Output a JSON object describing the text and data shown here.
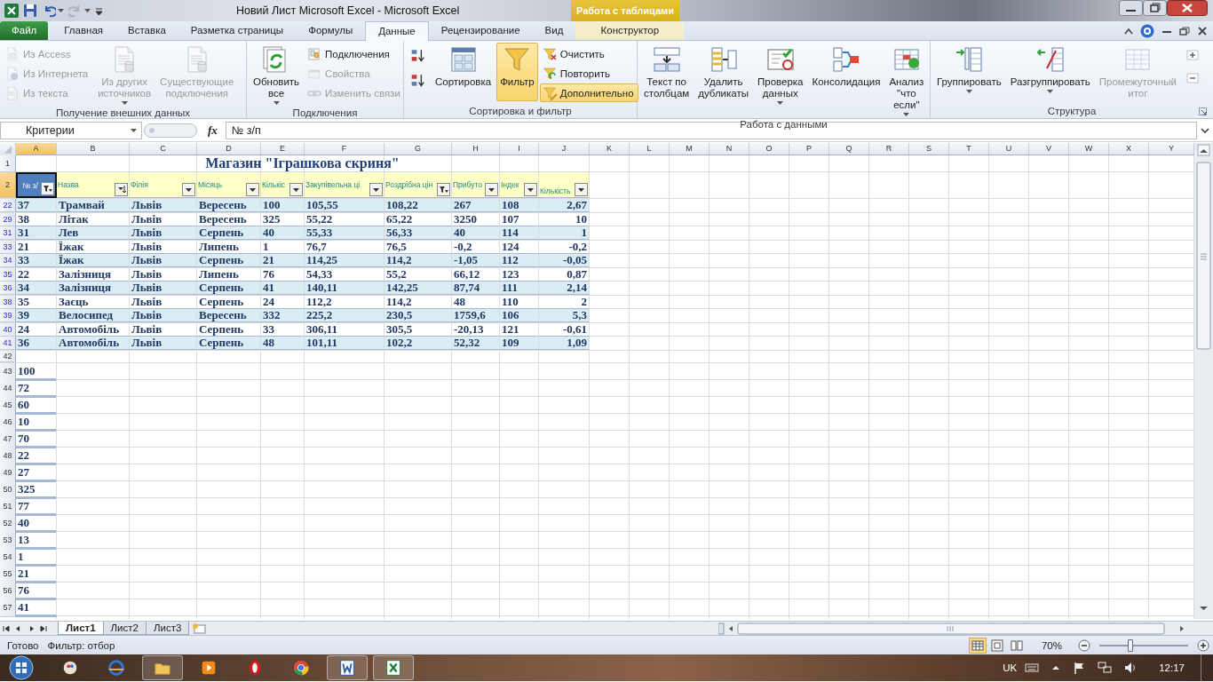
{
  "window": {
    "title": "Новий Лист Microsoft Excel  -  Microsoft Excel",
    "context_group": "Работа с таблицами"
  },
  "ribbon_tabs": [
    {
      "label": "Файл",
      "kind": "file",
      "selected": false
    },
    {
      "label": "Главная",
      "kind": "normal",
      "selected": false
    },
    {
      "label": "Вставка",
      "kind": "normal",
      "selected": false
    },
    {
      "label": "Разметка страницы",
      "kind": "normal",
      "selected": false
    },
    {
      "label": "Формулы",
      "kind": "normal",
      "selected": false
    },
    {
      "label": "Данные",
      "kind": "normal",
      "selected": true
    },
    {
      "label": "Рецензирование",
      "kind": "normal",
      "selected": false
    },
    {
      "label": "Вид",
      "kind": "normal",
      "selected": false
    },
    {
      "label": "Конструктор",
      "kind": "contextual",
      "selected": false
    }
  ],
  "ribbon_groups": [
    {
      "label": "Получение внешних данных",
      "items": [
        {
          "kind": "stack",
          "commands": [
            {
              "label": "Из Access",
              "disabled": true,
              "selected": false
            },
            {
              "label": "Из Интернета",
              "disabled": true,
              "selected": false
            },
            {
              "label": "Из текста",
              "disabled": true,
              "selected": false
            }
          ]
        },
        {
          "kind": "large",
          "label": "Из других\nисточников",
          "disabled": true,
          "dropdown": true,
          "selected": false
        },
        {
          "kind": "large",
          "label": "Существующие\nподключения",
          "disabled": true,
          "dropdown": false,
          "selected": false
        }
      ]
    },
    {
      "label": "Подключения",
      "items": [
        {
          "kind": "large",
          "label": "Обновить\nвсе",
          "disabled": false,
          "dropdown": true,
          "selected": false
        },
        {
          "kind": "stack",
          "commands": [
            {
              "label": "Подключения",
              "disabled": false,
              "selected": false
            },
            {
              "label": "Свойства",
              "disabled": true,
              "selected": false
            },
            {
              "label": "Изменить связи",
              "disabled": true,
              "selected": false
            }
          ]
        }
      ]
    },
    {
      "label": "Сортировка и фильтр",
      "items": [
        {
          "kind": "sort-buttons"
        },
        {
          "kind": "large",
          "label": "Сортировка",
          "disabled": false,
          "dropdown": false,
          "selected": false
        },
        {
          "kind": "large",
          "label": "Фильтр",
          "disabled": false,
          "dropdown": false,
          "selected": true
        },
        {
          "kind": "stack",
          "commands": [
            {
              "label": "Очистить",
              "disabled": false,
              "selected": false
            },
            {
              "label": "Повторить",
              "disabled": false,
              "selected": false
            },
            {
              "label": "Дополнительно",
              "disabled": false,
              "selected": true
            }
          ]
        }
      ]
    },
    {
      "label": "Работа с данными",
      "items": [
        {
          "kind": "large",
          "label": "Текст по\nстолбцам",
          "disabled": false,
          "dropdown": false,
          "selected": false
        },
        {
          "kind": "large",
          "label": "Удалить\nдубликаты",
          "disabled": false,
          "dropdown": false,
          "selected": false
        },
        {
          "kind": "large",
          "label": "Проверка\nданных",
          "disabled": false,
          "dropdown": true,
          "selected": false
        },
        {
          "kind": "large",
          "label": "Консолидация",
          "disabled": false,
          "dropdown": false,
          "selected": false
        },
        {
          "kind": "large",
          "label": "Анализ\n\"что если\"",
          "disabled": false,
          "dropdown": true,
          "selected": false
        }
      ]
    },
    {
      "label": "Структура",
      "dialog_launcher": true,
      "items": [
        {
          "kind": "large",
          "label": "Группировать",
          "disabled": false,
          "dropdown": true,
          "selected": false
        },
        {
          "kind": "large",
          "label": "Разгруппировать",
          "disabled": false,
          "dropdown": true,
          "selected": false
        },
        {
          "kind": "large",
          "label": "Промежуточный\nитог",
          "disabled": true,
          "dropdown": false,
          "selected": false
        },
        {
          "kind": "detail-buttons"
        }
      ]
    }
  ],
  "formula_bar": {
    "name_box": "Критерии",
    "function_symbol": "fx",
    "formula": "№ з/п"
  },
  "columns": [
    {
      "label": "A",
      "selected": true
    },
    {
      "label": "B",
      "selected": false
    },
    {
      "label": "C",
      "selected": false
    },
    {
      "label": "D",
      "selected": false
    },
    {
      "label": "E",
      "selected": false
    },
    {
      "label": "F",
      "selected": false
    },
    {
      "label": "G",
      "selected": false
    },
    {
      "label": "H",
      "selected": false
    },
    {
      "label": "I",
      "selected": false
    },
    {
      "label": "J",
      "selected": false
    },
    {
      "label": "K",
      "selected": false
    },
    {
      "label": "L",
      "selected": false
    },
    {
      "label": "M",
      "selected": false
    },
    {
      "label": "N",
      "selected": false
    },
    {
      "label": "O",
      "selected": false
    },
    {
      "label": "P",
      "selected": false
    },
    {
      "label": "Q",
      "selected": false
    },
    {
      "label": "R",
      "selected": false
    },
    {
      "label": "S",
      "selected": false
    },
    {
      "label": "T",
      "selected": false
    },
    {
      "label": "U",
      "selected": false
    },
    {
      "label": "V",
      "selected": false
    },
    {
      "label": "W",
      "selected": false
    },
    {
      "label": "X",
      "selected": false
    },
    {
      "label": "Y",
      "selected": false
    }
  ],
  "title_row": {
    "number": "1",
    "selected": false,
    "text": "Магазин \"Іграшкова скриня\""
  },
  "header_row": {
    "number": "2",
    "selected": true,
    "cells": [
      {
        "label": "№ з/",
        "kind": "filtered",
        "active": true
      },
      {
        "label": "Назва",
        "kind": "sorted",
        "active": false
      },
      {
        "label": "Філія",
        "kind": "dropdown",
        "active": false
      },
      {
        "label": "Місяць",
        "kind": "dropdown",
        "active": false
      },
      {
        "label": "Кількіс",
        "kind": "dropdown",
        "active": false
      },
      {
        "label": "Закупівельна ці",
        "kind": "dropdown",
        "active": false
      },
      {
        "label": "Роздрібна цін",
        "kind": "filtered",
        "active": false
      },
      {
        "label": "Прибуто",
        "kind": "dropdown",
        "active": false
      },
      {
        "label": "Індек",
        "kind": "dropdown",
        "active": false
      },
      {
        "label": "Кількість",
        "kind": "dropdown",
        "active": false
      }
    ]
  },
  "rows": [
    {
      "number": "22",
      "selected": false,
      "cells": [
        "37",
        "Трамвай",
        "Львів",
        "Вересень",
        "100",
        "105,55",
        "108,22",
        "267",
        "108",
        "2,67"
      ]
    },
    {
      "number": "29",
      "selected": false,
      "cells": [
        "38",
        "Літак",
        "Львів",
        "Вересень",
        "325",
        "55,22",
        "65,22",
        "3250",
        "107",
        "10"
      ]
    },
    {
      "number": "31",
      "selected": false,
      "cells": [
        "31",
        "Лев",
        "Львів",
        "Серпень",
        "40",
        "55,33",
        "56,33",
        "40",
        "114",
        "1"
      ]
    },
    {
      "number": "33",
      "selected": false,
      "cells": [
        "21",
        "Їжак",
        "Львів",
        "Липень",
        "1",
        "76,7",
        "76,5",
        "-0,2",
        "124",
        "-0,2"
      ]
    },
    {
      "number": "34",
      "selected": false,
      "cells": [
        "33",
        "Їжак",
        "Львів",
        "Серпень",
        "21",
        "114,25",
        "114,2",
        "-1,05",
        "112",
        "-0,05"
      ]
    },
    {
      "number": "35",
      "selected": false,
      "cells": [
        "22",
        "Залізниця",
        "Львів",
        "Липень",
        "76",
        "54,33",
        "55,2",
        "66,12",
        "123",
        "0,87"
      ]
    },
    {
      "number": "36",
      "selected": false,
      "cells": [
        "34",
        "Залізниця",
        "Львів",
        "Серпень",
        "41",
        "140,11",
        "142,25",
        "87,74",
        "111",
        "2,14"
      ]
    },
    {
      "number": "38",
      "selected": false,
      "cells": [
        "35",
        "Заєць",
        "Львів",
        "Серпень",
        "24",
        "112,2",
        "114,2",
        "48",
        "110",
        "2"
      ]
    },
    {
      "number": "39",
      "selected": false,
      "cells": [
        "39",
        "Велосипед",
        "Львів",
        "Вересень",
        "332",
        "225,2",
        "230,5",
        "1759,6",
        "106",
        "5,3"
      ]
    },
    {
      "number": "40",
      "selected": false,
      "cells": [
        "24",
        "Автомобіль",
        "Львів",
        "Серпень",
        "33",
        "306,11",
        "305,5",
        "-20,13",
        "121",
        "-0,61"
      ]
    },
    {
      "number": "41",
      "selected": false,
      "cells": [
        "36",
        "Автомобіль",
        "Львів",
        "Серпень",
        "48",
        "101,11",
        "102,2",
        "52,32",
        "109",
        "1,09"
      ]
    }
  ],
  "empty_row": {
    "number": "42",
    "selected": false
  },
  "criteria_rows": [
    {
      "number": "43",
      "selected": false,
      "value": "100"
    },
    {
      "number": "44",
      "selected": false,
      "value": "72"
    },
    {
      "number": "45",
      "selected": false,
      "value": "60"
    },
    {
      "number": "46",
      "selected": false,
      "value": "10"
    },
    {
      "number": "47",
      "selected": false,
      "value": "70"
    },
    {
      "number": "48",
      "selected": false,
      "value": "22"
    },
    {
      "number": "49",
      "selected": false,
      "value": "27"
    },
    {
      "number": "50",
      "selected": false,
      "value": "325"
    },
    {
      "number": "51",
      "selected": false,
      "value": "77"
    },
    {
      "number": "52",
      "selected": false,
      "value": "40"
    },
    {
      "number": "53",
      "selected": false,
      "value": "13"
    },
    {
      "number": "54",
      "selected": false,
      "value": "1"
    },
    {
      "number": "55",
      "selected": false,
      "value": "21"
    },
    {
      "number": "56",
      "selected": false,
      "value": "76"
    },
    {
      "number": "57",
      "selected": false,
      "value": "41"
    }
  ],
  "sheet_tabs": [
    {
      "label": "Лист1",
      "selected": true
    },
    {
      "label": "Лист2",
      "selected": false
    },
    {
      "label": "Лист3",
      "selected": false
    }
  ],
  "status_bar": {
    "ready": "Готово",
    "filter_mode": "Фильтр: отбор",
    "views": [
      {
        "selected": true
      },
      {
        "selected": false
      },
      {
        "selected": false
      }
    ],
    "zoom": "70%",
    "zoom_slider": {
      "level": 0.35
    }
  },
  "taskbar": {
    "apps": [
      {
        "running": false
      },
      {
        "running": false
      },
      {
        "running": true
      },
      {
        "running": false
      },
      {
        "running": false
      },
      {
        "running": false
      },
      {
        "running": true
      },
      {
        "running": true
      }
    ],
    "language": "UK",
    "time": "12:17"
  }
}
